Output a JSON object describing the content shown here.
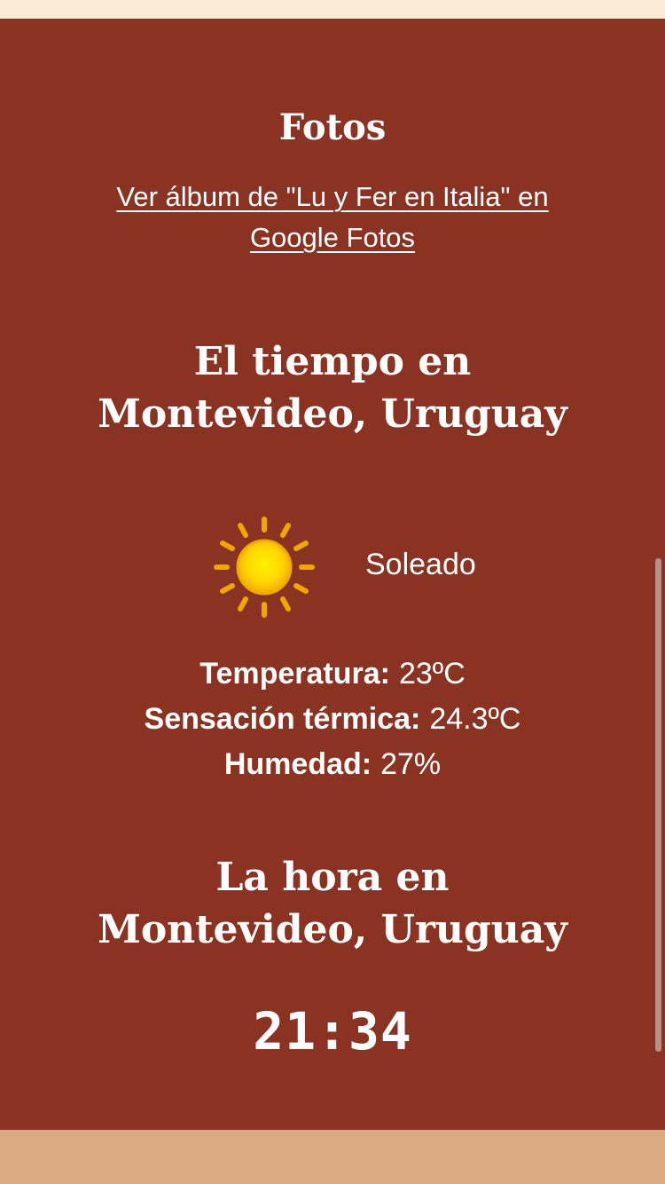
{
  "colors": {
    "panel_bg": "#8a3322",
    "top_band": "#faebd7",
    "bottom_band": "#dbab84",
    "text": "#ffffff",
    "sun_core": "#ffd700",
    "sun_rays": "#f0a800"
  },
  "photos": {
    "title": "Fotos",
    "link_text": "Ver álbum de \"Lu y Fer en Italia\" en Google Fotos"
  },
  "weather": {
    "title": "El tiempo en Montevideo, Uruguay",
    "icon": "sun-icon",
    "condition": "Soleado",
    "stats": [
      {
        "label": "Temperatura:",
        "value": "23ºC"
      },
      {
        "label": "Sensación térmica:",
        "value": "24.3ºC"
      },
      {
        "label": "Humedad:",
        "value": "27%"
      }
    ]
  },
  "time": {
    "title": "La hora en Montevideo, Uruguay",
    "clock": "21:34"
  }
}
